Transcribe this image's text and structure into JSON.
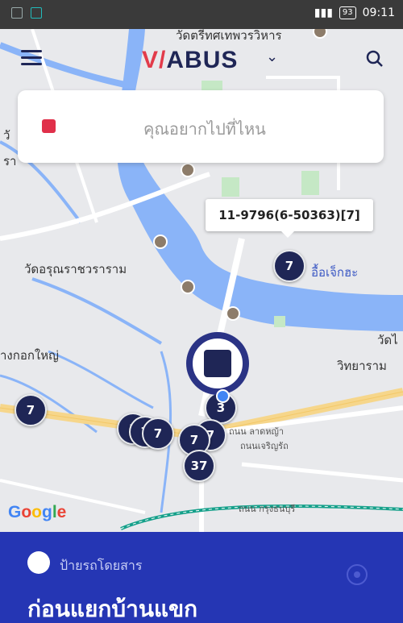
{
  "status_bar": {
    "battery": "93",
    "time": "09:11"
  },
  "app": {
    "logo_accent": "V/",
    "logo_text": "ABUS",
    "brand_color": "#1f2656",
    "accent_color": "#e23b4a"
  },
  "search": {
    "placeholder": "คุณอยากไปที่ไหน"
  },
  "map": {
    "places": {
      "wat_top": "วัดตรีทศเทพวรวิหาร",
      "wat_arun": "วัดอรุณราชวราราม",
      "east": "อื้อเจ็กฮะ",
      "bangkok_yai": "างกอกใหญ่",
      "wat_right": "วัดไ",
      "science": "วิทยาราม",
      "road1": "ถนน ลาดหญ้า",
      "road2": "ถนนเจริญรัถ",
      "road3": "ถนน กรุงธนบุรี",
      "left_a": "วั",
      "left_b": "รา"
    },
    "tooltip": "11-9796(6-50363)[7]",
    "bus_markers": [
      "7",
      "7",
      "7",
      "7",
      "3",
      "7",
      "7",
      "37",
      "1",
      "7"
    ],
    "attribution": "Google"
  },
  "bottom_sheet": {
    "label": "ป้ายรถโดยสาร",
    "title": "ก่อนแยกบ้านแขก"
  }
}
